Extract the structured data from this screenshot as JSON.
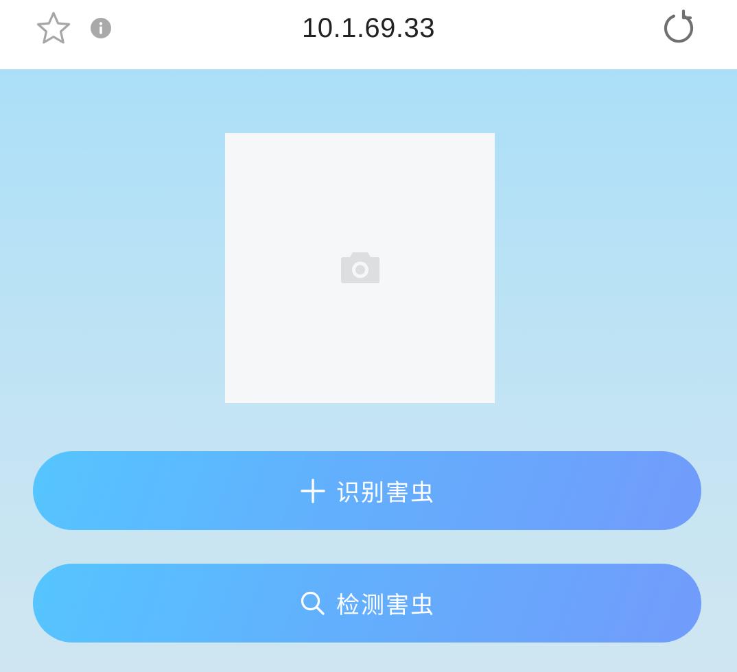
{
  "browser": {
    "url": "10.1.69.33",
    "icons": {
      "bookmark": "star-outline-icon",
      "site_info": "info-circle-icon",
      "reload": "reload-icon"
    }
  },
  "uploader": {
    "icon": "camera-icon"
  },
  "actions": {
    "identify_label": "识别害虫",
    "identify_icon": "plus-icon",
    "detect_label": "检测害虫",
    "detect_icon": "search-icon"
  },
  "colors": {
    "button_gradient_start": "#55c5fe",
    "button_gradient_end": "#719bfb",
    "background_top": "#abdff8",
    "background_bottom": "#cfe6f2",
    "uploader_bg": "#f5f7f9"
  }
}
